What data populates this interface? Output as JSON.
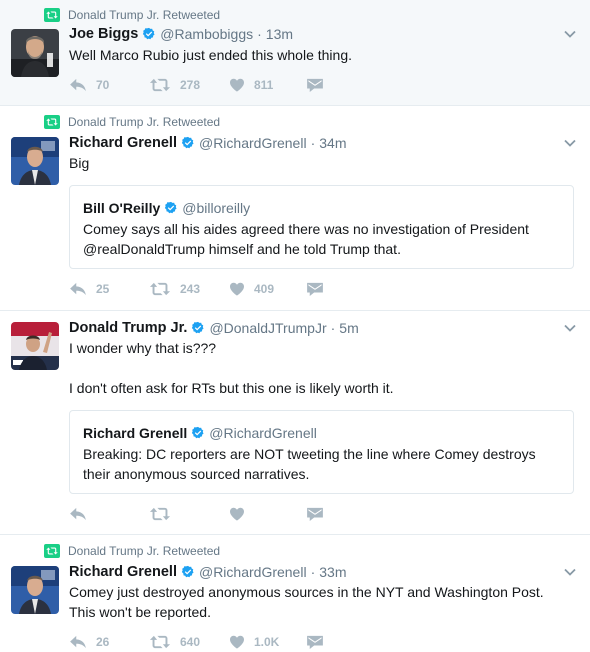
{
  "tweets": [
    {
      "retweeted_by": "Donald Trump Jr. Retweeted",
      "name": "Joe Biggs",
      "handle": "@Rambobiggs",
      "time": "13m",
      "text": "Well Marco Rubio just ended this whole thing.",
      "replies": "70",
      "retweets": "278",
      "likes": "811"
    },
    {
      "retweeted_by": "Donald Trump Jr. Retweeted",
      "name": "Richard Grenell",
      "handle": "@RichardGrenell",
      "time": "34m",
      "text": "Big",
      "quote": {
        "name": "Bill O'Reilly",
        "handle": "@billoreilly",
        "text": "Comey says all his aides agreed there was no investigation of President @realDonaldTrump himself and he told Trump that."
      },
      "replies": "25",
      "retweets": "243",
      "likes": "409"
    },
    {
      "name": "Donald Trump Jr.",
      "handle": "@DonaldJTrumpJr",
      "time": "5m",
      "text_line1": "I wonder why that is???",
      "text_line2": "I don't often ask for RTs but this one is likely worth it.",
      "quote": {
        "name": "Richard Grenell",
        "handle": "@RichardGrenell",
        "text": "Breaking: DC reporters are NOT tweeting the line where Comey destroys their anonymous sourced narratives."
      }
    },
    {
      "retweeted_by": "Donald Trump Jr. Retweeted",
      "name": "Richard Grenell",
      "handle": "@RichardGrenell",
      "time": "33m",
      "text": "Comey just destroyed anonymous sources in the NYT and Washington Post. This won't be reported.",
      "replies": "26",
      "retweets": "640",
      "likes": "1.0K"
    }
  ],
  "separator": "·",
  "icons": {
    "retweeted": "retweet-icon",
    "verified": "verified-badge-icon",
    "caret": "chevron-down-icon",
    "reply": "reply-icon",
    "retweet": "retweet-icon",
    "like": "heart-icon",
    "dm": "envelope-icon"
  },
  "colors": {
    "retweet_green": "#19cf86",
    "verified_blue": "#1da1f2",
    "muted": "#657786",
    "action_gray": "#aab8c2",
    "highlight_bg": "#f5f8fa"
  }
}
